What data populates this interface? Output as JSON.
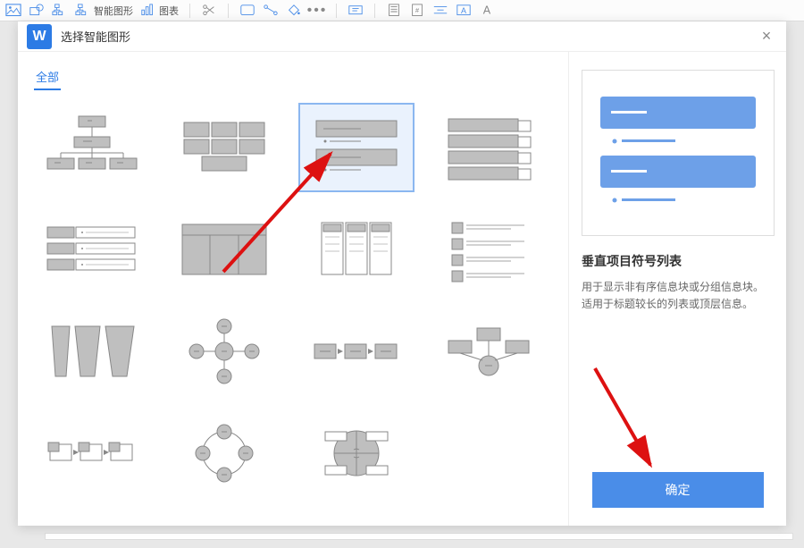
{
  "toolbar": {
    "left_label": "图片",
    "smartart_label": "智能图形",
    "chart_label": "图表"
  },
  "modal": {
    "app_icon_text": "W",
    "title": "选择智能图形",
    "tab_all": "全部",
    "close": "×"
  },
  "preview": {
    "title": "垂直项目符号列表",
    "desc": "用于显示非有序信息块或分组信息块。适用于标题较长的列表或顶层信息。",
    "confirm": "确定"
  }
}
